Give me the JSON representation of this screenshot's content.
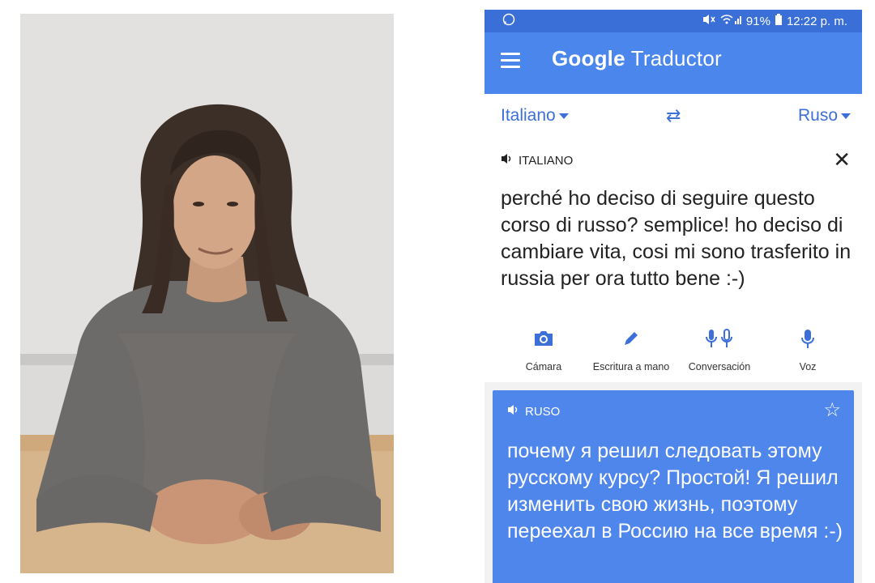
{
  "status_bar": {
    "left_icon": "whatsapp-icon",
    "battery": "91%",
    "time": "12:22 p. m."
  },
  "app_bar": {
    "menu_icon": "hamburger-menu-icon",
    "title_brand": "Google",
    "title_product": "Traductor"
  },
  "language_bar": {
    "source": "Italiano",
    "target": "Ruso",
    "swap_icon": "swap-arrows-icon"
  },
  "input": {
    "language_label": "ITALIANO",
    "text": "perché ho deciso di seguire questo corso di russo? semplice! ho deciso di cambiare vita, cosi mi sono trasferito in russia  per ora tutto bene :-)"
  },
  "tools": [
    {
      "label": "Cámara",
      "icon": "camera-icon"
    },
    {
      "label": "Escritura a mano",
      "icon": "pen-icon"
    },
    {
      "label": "Conversación",
      "icon": "conversation-mic-icon"
    },
    {
      "label": "Voz",
      "icon": "mic-icon"
    }
  ],
  "output": {
    "language_label": "RUSO",
    "text": "почему я решил следовать этому русскому курсу? Простой! Я решил изменить свою жизнь, поэтому переехал в Россию на все время :-)"
  },
  "colors": {
    "app_blue": "#4a86ec",
    "status_blue": "#3a6fd8",
    "link_blue": "#3c6fd8",
    "output_card_blue": "#4f86ec"
  }
}
